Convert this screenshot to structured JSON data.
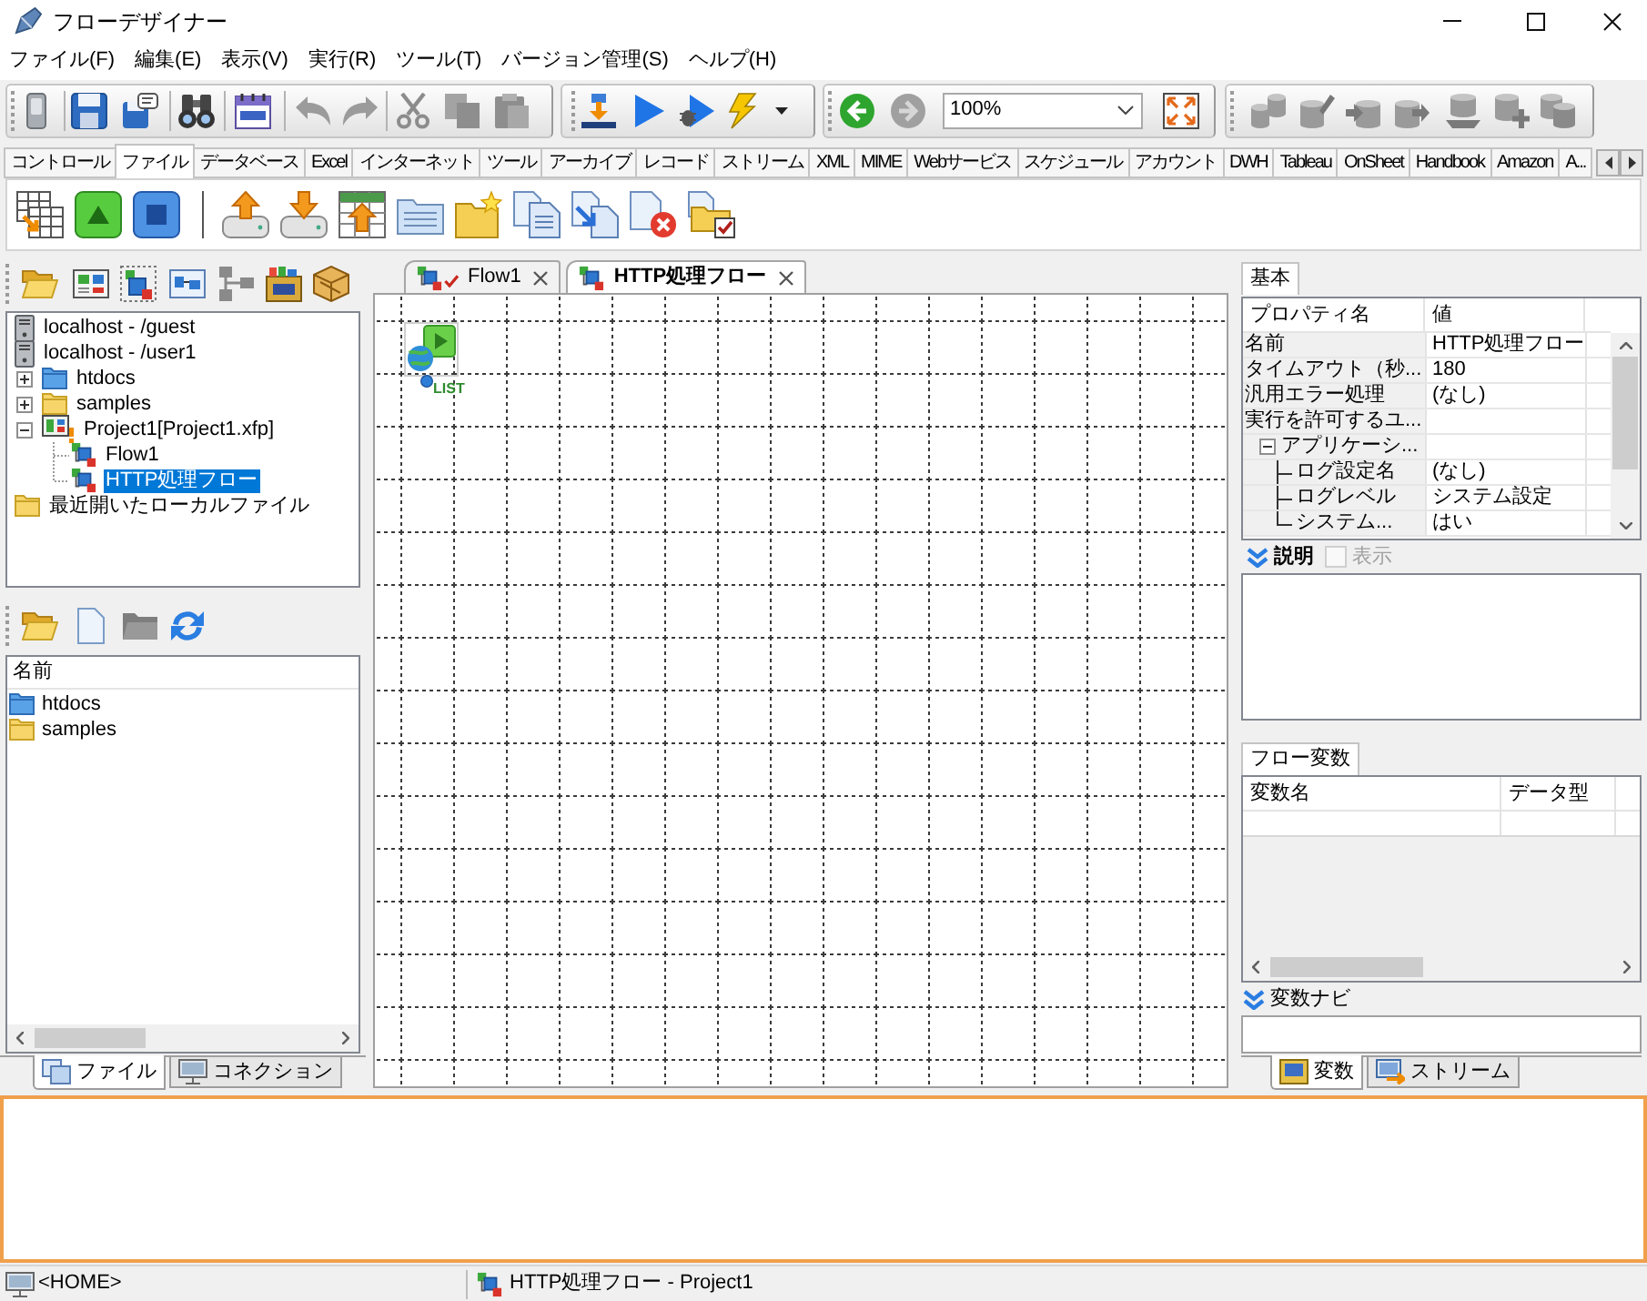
{
  "window": {
    "title": "フローデザイナー"
  },
  "menu": [
    "ファイル(F)",
    "編集(E)",
    "表示(V)",
    "実行(R)",
    "ツール(T)",
    "バージョン管理(S)",
    "ヘルプ(H)"
  ],
  "toolbar": {
    "zoom": "100%"
  },
  "palette": {
    "tabs": [
      {
        "label": "コントロール",
        "selected": false
      },
      {
        "label": "ファイル",
        "selected": true
      },
      {
        "label": "データベース",
        "selected": false
      },
      {
        "label": "Excel",
        "selected": false
      },
      {
        "label": "インターネット",
        "selected": false
      },
      {
        "label": "ツール",
        "selected": false
      },
      {
        "label": "アーカイブ",
        "selected": false
      },
      {
        "label": "レコード",
        "selected": false
      },
      {
        "label": "ストリーム",
        "selected": false
      },
      {
        "label": "XML",
        "selected": false
      },
      {
        "label": "MIME",
        "selected": false
      },
      {
        "label": "Webサービス",
        "selected": false
      },
      {
        "label": "スケジュール",
        "selected": false
      },
      {
        "label": "アカウント",
        "selected": false
      },
      {
        "label": "DWH",
        "selected": false
      },
      {
        "label": "Tableau",
        "selected": false
      },
      {
        "label": "OnSheet",
        "selected": false
      },
      {
        "label": "Handbook",
        "selected": false
      },
      {
        "label": "Amazon",
        "selected": false
      },
      {
        "label": "A...",
        "selected": false
      }
    ]
  },
  "explorer": {
    "tree": [
      {
        "label": "localhost - /guest",
        "kind": "server",
        "selected": false
      },
      {
        "label": "localhost - /user1",
        "kind": "server",
        "selected": false,
        "children": [
          {
            "label": "htdocs",
            "kind": "web-folder",
            "expanded": false,
            "selected": false
          },
          {
            "label": "samples",
            "kind": "folder",
            "expanded": false,
            "selected": false
          },
          {
            "label": "Project1[Project1.xfp]",
            "kind": "project",
            "expanded": true,
            "selected": false,
            "children": [
              {
                "label": "Flow1",
                "kind": "flow",
                "selected": false
              },
              {
                "label": "HTTP処理フロー",
                "kind": "flow",
                "selected": true
              }
            ]
          }
        ]
      },
      {
        "label": "最近開いたローカルファイル",
        "kind": "folder",
        "selected": false
      }
    ],
    "list": {
      "columns": [
        "名前"
      ],
      "rows": [
        {
          "name": "htdocs",
          "kind": "web-folder"
        },
        {
          "name": "samples",
          "kind": "folder"
        }
      ]
    },
    "tabs": [
      {
        "label": "ファイル",
        "selected": true
      },
      {
        "label": "コネクション",
        "selected": false
      }
    ]
  },
  "editor": {
    "tabs": [
      {
        "label": "Flow1",
        "selected": false,
        "verified": true
      },
      {
        "label": "HTTP処理フロー",
        "selected": true,
        "verified": false
      }
    ],
    "nodes": [
      {
        "kind": "start",
        "label": "LIST"
      }
    ]
  },
  "properties": {
    "tab": "基本",
    "columns": [
      "プロパティ名",
      "値"
    ],
    "rows": [
      {
        "name": "名前",
        "value": "HTTP処理フロー"
      },
      {
        "name": "タイムアウト（秒...",
        "value": "180"
      },
      {
        "name": "汎用エラー処理",
        "value": "(なし)"
      },
      {
        "name": "実行を許可するユ..."
      },
      {
        "name": "アプリケーシ...",
        "expanded": true,
        "children": [
          {
            "name": "ログ設定名",
            "value": "(なし)"
          },
          {
            "name": "ログレベル",
            "value": "システム設定"
          },
          {
            "name": "システム...",
            "value": "はい"
          }
        ]
      }
    ]
  },
  "description": {
    "label": "説明",
    "checkbox": {
      "label": "表示",
      "checked": false,
      "disabled": true
    }
  },
  "variables": {
    "tab": "フロー変数",
    "columns": [
      "変数名",
      "データ型"
    ]
  },
  "variable_navi": {
    "label": "変数ナビ"
  },
  "inspector_tabs": [
    {
      "label": "変数",
      "selected": true
    },
    {
      "label": "ストリーム",
      "selected": false
    }
  ],
  "status_bar": {
    "location": "<HOME>",
    "flow": "HTTP処理フロー - Project1"
  }
}
